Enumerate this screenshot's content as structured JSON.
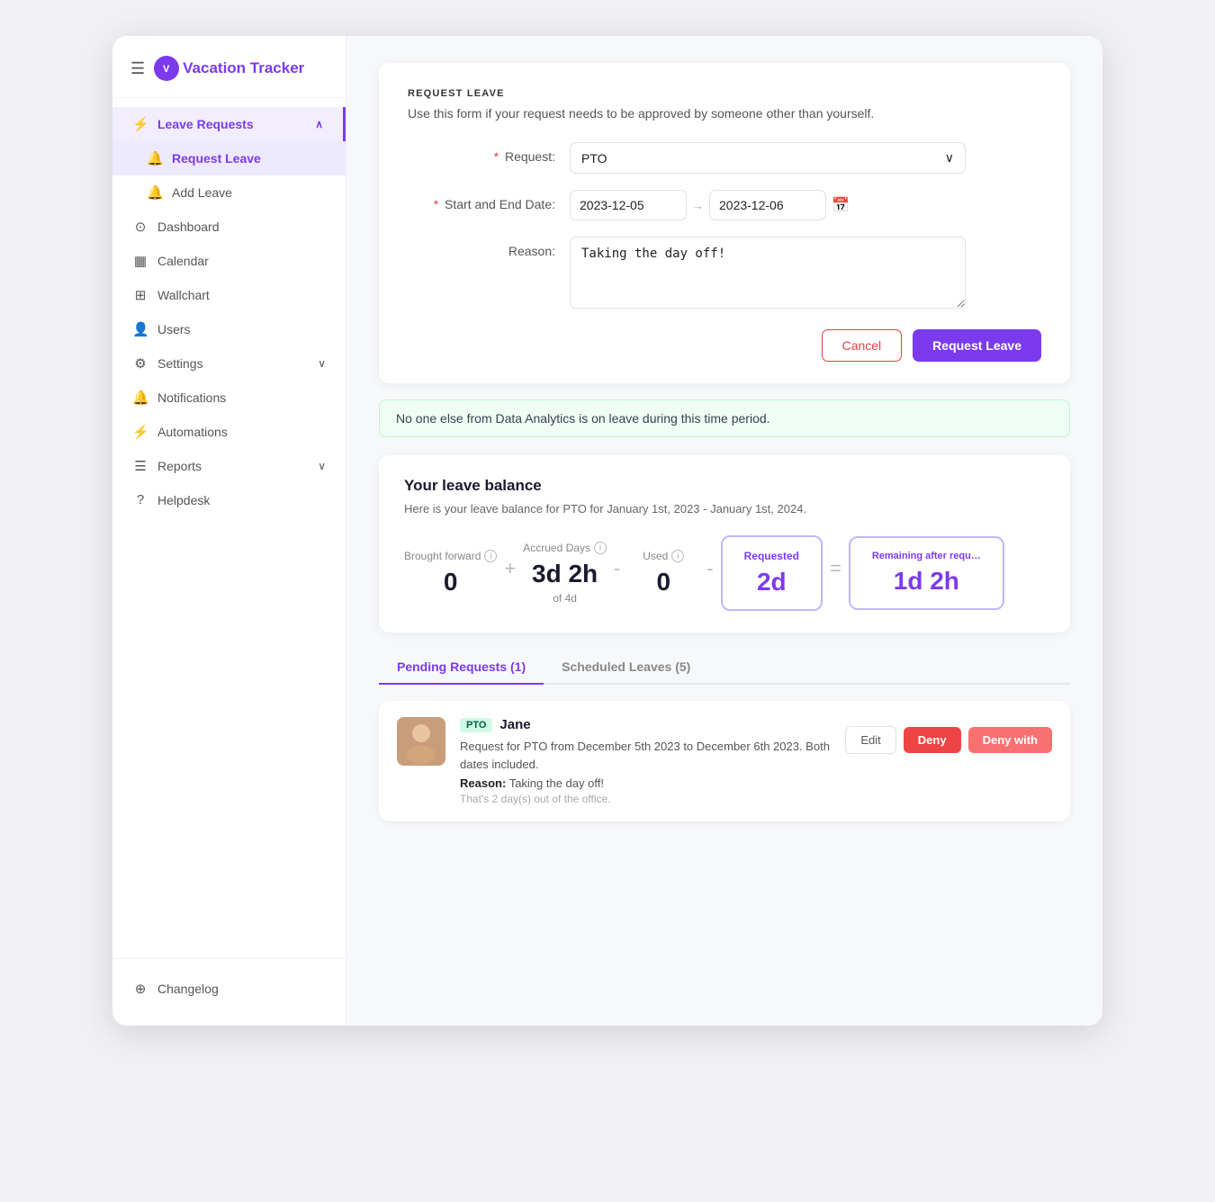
{
  "app": {
    "logo_letter": "V",
    "logo_text_italic": "V",
    "logo_text_rest": "acation Tracker"
  },
  "sidebar": {
    "hamburger": "☰",
    "items": [
      {
        "id": "leave-requests",
        "label": "Leave Requests",
        "icon": "⚡",
        "active": true,
        "has_chevron": true
      },
      {
        "id": "request-leave",
        "label": "Request Leave",
        "icon": "🔔",
        "sub": true,
        "sub_active": true
      },
      {
        "id": "add-leave",
        "label": "Add Leave",
        "icon": "🔔",
        "sub": true
      },
      {
        "id": "dashboard",
        "label": "Dashboard",
        "icon": "⊙"
      },
      {
        "id": "calendar",
        "label": "Calendar",
        "icon": "▦"
      },
      {
        "id": "wallchart",
        "label": "Wallchart",
        "icon": "⊞"
      },
      {
        "id": "users",
        "label": "Users",
        "icon": "👤"
      },
      {
        "id": "settings",
        "label": "Settings",
        "icon": "⚙",
        "has_chevron": true
      },
      {
        "id": "notifications",
        "label": "Notifications",
        "icon": "🔔"
      },
      {
        "id": "automations",
        "label": "Automations",
        "icon": "⚡"
      },
      {
        "id": "reports",
        "label": "Reports",
        "icon": "☰",
        "has_chevron": true
      },
      {
        "id": "helpdesk",
        "label": "Helpdesk",
        "icon": "?"
      }
    ],
    "bottom_item": {
      "id": "changelog",
      "label": "Changelog",
      "icon": "⊕"
    }
  },
  "main": {
    "section_title": "REQUEST LEAVE",
    "section_desc": "Use this form if your request needs to be approved by someone other than yourself.",
    "form": {
      "request_label": "Request:",
      "request_required": "*",
      "request_value": "PTO",
      "date_label": "Start and End Date:",
      "date_required": "*",
      "date_start": "2023-12-05",
      "date_end": "2023-12-06",
      "reason_label": "Reason:",
      "reason_value": "Taking the day off!",
      "cancel_label": "Cancel",
      "submit_label": "Request Leave"
    },
    "info_banner": "No one else from Data Analytics is on leave during this time period.",
    "balance": {
      "title": "Your leave balance",
      "subtitle": "Here is your leave balance for PTO for January 1st, 2023 - January 1st, 2024.",
      "items": [
        {
          "id": "brought-forward",
          "label": "Brought forward",
          "value": "0",
          "sub": ""
        },
        {
          "op": "+"
        },
        {
          "id": "accrued-days",
          "label": "Accrued Days",
          "value": "3d 2h",
          "sub": "of 4d"
        },
        {
          "op": "-"
        },
        {
          "id": "used",
          "label": "Used",
          "value": "0",
          "sub": ""
        },
        {
          "op": "-"
        },
        {
          "id": "requested",
          "label": "Requested",
          "value": "2d",
          "sub": "",
          "highlight": true
        },
        {
          "op": "="
        },
        {
          "id": "remaining",
          "label": "Remaining after requ...",
          "value": "1d 2h",
          "sub": "",
          "highlight": true
        }
      ]
    },
    "tabs": [
      {
        "id": "pending",
        "label": "Pending Requests (1)",
        "active": true
      },
      {
        "id": "scheduled",
        "label": "Scheduled Leaves (5)",
        "active": false
      }
    ],
    "request_item": {
      "avatar_emoji": "👩",
      "pto_badge": "PTO",
      "name": "Jane",
      "description": "Request for PTO from December 5th 2023 to December 6th 2023. Both dates included.",
      "reason_label": "Reason:",
      "reason_value": "Taking the day off!",
      "note": "That's 2 day(s) out of the office.",
      "edit_label": "Edit",
      "deny_label": "Deny",
      "deny_with_label": "Deny with"
    }
  }
}
